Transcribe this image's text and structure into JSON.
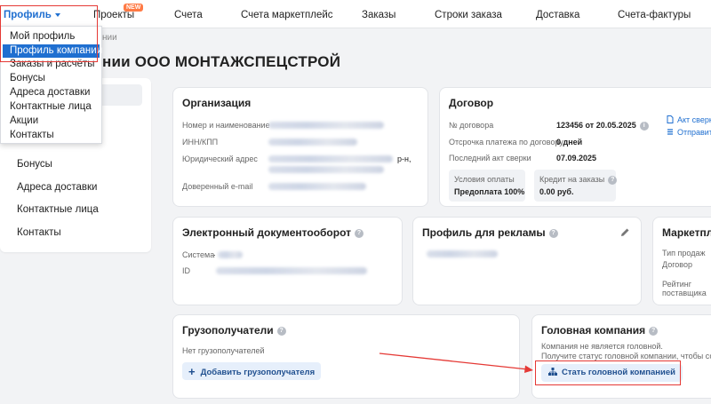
{
  "nav": {
    "profile": "Профиль",
    "projects": "Проекты",
    "new_badge": "NEW",
    "invoices": "Счета",
    "marketplace_invoices": "Счета маркетплейс",
    "orders": "Заказы",
    "order_lines": "Строки заказа",
    "delivery": "Доставка",
    "factura": "Счета-фактуры"
  },
  "breadcrumb": "нии",
  "page_title": "нии ООО МОНТАЖСПЕЦСТРОЙ",
  "dropdown": {
    "items": [
      "Мой профиль",
      "Профиль компании",
      "Заказы и расчёты",
      "Бонусы",
      "Адреса доставки",
      "Контактные лица",
      "Акции",
      "Контакты"
    ],
    "selected": "Профиль компании"
  },
  "sidebar": {
    "items": [
      "Бонусы",
      "Адреса доставки",
      "Контактные лица",
      "Контакты"
    ]
  },
  "organization": {
    "title": "Организация",
    "number_label": "Номер и наименование",
    "inn_label": "ИНН/КПП",
    "address_label": "Юридический адрес",
    "address_tail": "р-н,",
    "email_label": "Доверенный e-mail"
  },
  "contract": {
    "title": "Договор",
    "number_label": "№ договора",
    "number_value": "123456 от 20.05.2025",
    "deferral_label": "Отсрочка платежа по договору",
    "deferral_value": "0 дней",
    "last_act_label": "Последний акт сверки",
    "last_act_value": "07.09.2025",
    "payment_terms_label": "Условия оплаты",
    "payment_terms_value": "Предоплата 100%",
    "credit_label": "Кредит на заказы",
    "credit_value": "0.00 руб.",
    "act_link": "Акт сверки",
    "send_link": "Отправит"
  },
  "edo": {
    "title": "Электронный документооборот",
    "system_label": "Система",
    "system_value": ".",
    "id_label": "ID"
  },
  "ad_profile": {
    "title": "Профиль для рекламы"
  },
  "marketplace": {
    "title": "Маркетпле",
    "sales_type_label": "Тип продаж",
    "contract_label": "Договор",
    "rating_label_1": "Рейтинг",
    "rating_label_2": "поставщика"
  },
  "consignees": {
    "title": "Грузополучатели",
    "empty_text": "Нет грузополучателей",
    "add_button": "Добавить грузополучателя"
  },
  "parent_company": {
    "title": "Головная компания",
    "line1": "Компания не является головной.",
    "line2": "Получите статус головной компании, чтобы созда",
    "become_button": "Стать головной компанией"
  },
  "colors": {
    "accent": "#1f6fd0",
    "highlight": "#e53935",
    "badge": "#ff7a45"
  }
}
